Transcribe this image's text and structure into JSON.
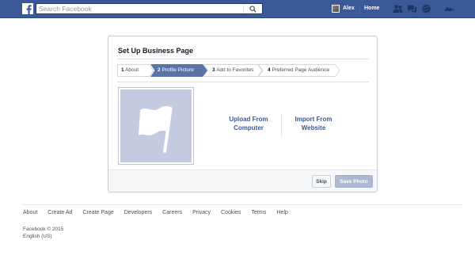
{
  "header": {
    "search_placeholder": "Search Facebook",
    "user_name": "Alex",
    "home_label": "Home"
  },
  "dialog": {
    "title": "Set Up Business Page",
    "steps": [
      {
        "num": "1",
        "label": "About",
        "active": false
      },
      {
        "num": "2",
        "label": "Profile Picture",
        "active": true
      },
      {
        "num": "3",
        "label": "Add to Favorites",
        "active": false
      },
      {
        "num": "4",
        "label": "Preferred Page Audience",
        "active": false
      }
    ],
    "upload_line1": "Upload From",
    "upload_line2": "Computer",
    "import_line1": "Import From",
    "import_line2": "Website",
    "skip_label": "Skip",
    "save_label": "Save Photo"
  },
  "footer": {
    "links": [
      "About",
      "Create Ad",
      "Create Page",
      "Developers",
      "Careers",
      "Privacy",
      "Cookies",
      "Terms",
      "Help"
    ],
    "copyright": "Facebook © 2015",
    "language": "English (US)"
  },
  "colors": {
    "brand_blue": "#3b5998",
    "active_step": "#5b74a8",
    "placeholder_photo": "#c4cae0"
  },
  "icons": [
    "facebook-logo-icon",
    "search-icon",
    "friend-requests-icon",
    "messages-icon",
    "notifications-icon",
    "settings-caret-icon",
    "flag-icon"
  ]
}
